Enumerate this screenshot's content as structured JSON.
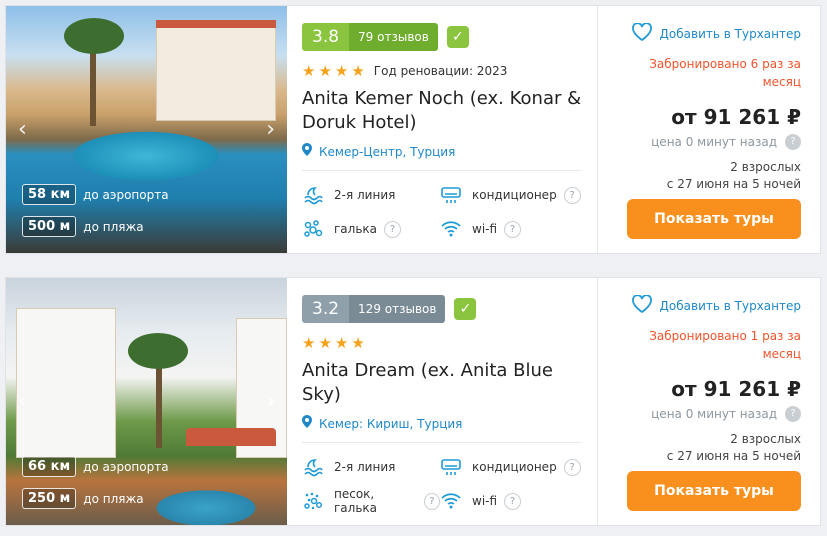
{
  "hotels": [
    {
      "rating": "3.8",
      "reviews": "79 отзывов",
      "rating_color": "#8bc53f",
      "stars": "★★★★",
      "renovation": "Год реновации: 2023",
      "name": "Anita Kemer Noch (ex. Konar & Doruk Hotel)",
      "location": "Кемер-Центр, Турция",
      "airport_distance": "58 км",
      "airport_label": "до аэропорта",
      "beach_distance": "500 м",
      "beach_label": "до пляжа",
      "features": {
        "line": "2-я линия",
        "ac": "кондиционер",
        "beach_type": "галька",
        "wifi": "wi-fi"
      },
      "favorite": "Добавить в Турхантер",
      "booked": "Забронировано 6 раз за месяц",
      "price": "от 91 261 ₽",
      "price_ago": "цена 0 минут назад",
      "pax_line1": "2 взрослых",
      "pax_line2": "с 27 июня на 5 ночей",
      "button": "Показать туры"
    },
    {
      "rating": "3.2",
      "reviews": "129 отзывов",
      "rating_color": "#8fa0ab",
      "stars": "★★★★",
      "renovation": "",
      "name": "Anita Dream (ex. Anita Blue Sky)",
      "location": "Кемер: Кириш, Турция",
      "airport_distance": "66 км",
      "airport_label": "до аэропорта",
      "beach_distance": "250 м",
      "beach_label": "до пляжа",
      "features": {
        "line": "2-я линия",
        "ac": "кондиционер",
        "beach_type": "песок, галька",
        "wifi": "wi-fi"
      },
      "favorite": "Добавить в Турхантер",
      "booked": "Забронировано 1 раз за месяц",
      "price": "от 91 261 ₽",
      "price_ago": "цена 0 минут назад",
      "pax_line1": "2 взрослых",
      "pax_line2": "с 27 июня на 5 ночей",
      "button": "Показать туры"
    }
  ],
  "icons": {
    "prev": "‹",
    "next": "›",
    "verified": "✓",
    "pin": "●",
    "heart": "♡",
    "question": "?"
  }
}
